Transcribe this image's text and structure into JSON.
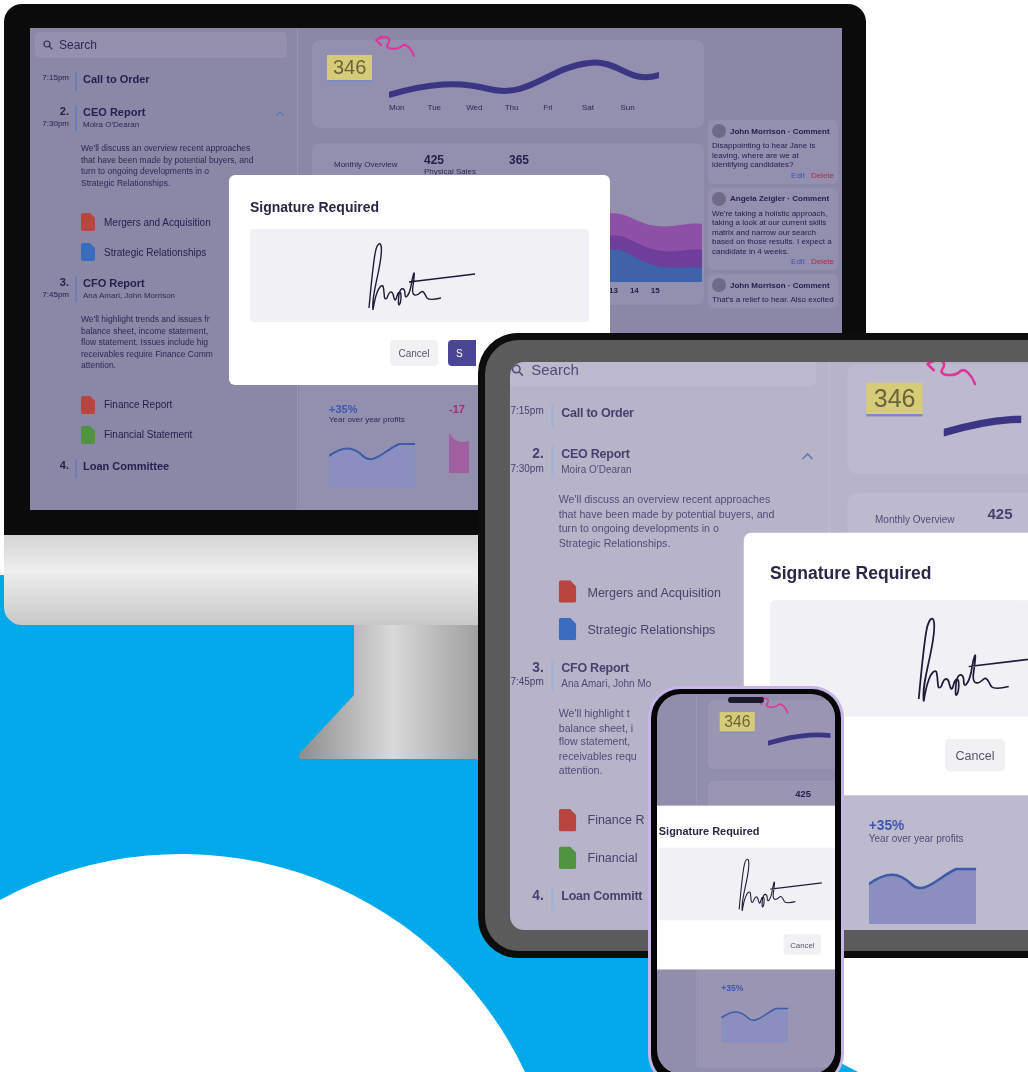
{
  "devices": [
    {
      "kind": "monitor",
      "app": {
        "search": {
          "placeholder": "Search"
        },
        "agenda": [
          {
            "time": "7:15pm",
            "title": "Call to Order"
          },
          {
            "number": "2.",
            "time": "7:30pm",
            "title": "CEO Report",
            "presenter": "Moira O'Dearan",
            "expanded": true,
            "description": "We'll discuss an overview recent approaches\nthat have been made by potential buyers, and\nturn to ongoing developments in o\nStrategic Relationships.",
            "attachments": [
              {
                "name": "Mergers and Acquisition",
                "kind": "pdf"
              },
              {
                "name": "Strategic Relationships",
                "kind": "word"
              }
            ]
          },
          {
            "number": "3.",
            "time": "7:45pm",
            "title": "CFO Report",
            "presenter": "Ana Amari, John Morrison",
            "description": "We'll highlight trends and issues fr\nbalance sheet, income statement,\nflow statement. Issues include hig\nreceivables require Finance Comm\nattention.",
            "attachments": [
              {
                "name": "Finance Report",
                "kind": "pdf"
              },
              {
                "name": "Financial Statement",
                "kind": "excel"
              }
            ]
          },
          {
            "number": "4.",
            "title": "Loan Committee"
          }
        ],
        "highlight": {
          "value": "346"
        },
        "days": [
          "Mon",
          "Tue",
          "Wed",
          "Thu",
          "Fri",
          "Sat",
          "Sun"
        ],
        "overview": {
          "title": "Monthly Overview",
          "stats": [
            {
              "value": "425",
              "label": "Physical Sales"
            },
            {
              "value": "365"
            }
          ],
          "axis": [
            "13",
            "14",
            "15"
          ]
        },
        "profits": [
          {
            "value": "+35%",
            "label": "Year over year profits",
            "kind": "gain"
          },
          {
            "value": "-17",
            "kind": "loss"
          }
        ],
        "comments": [
          {
            "author": "John Morrison · Comment",
            "text": "Disappointing to hear Jane is leaving, where are we at identifying candidates?",
            "actions": [
              {
                "label": "Edit",
                "kind": "edit"
              },
              {
                "label": "Delete",
                "kind": "delete"
              }
            ]
          },
          {
            "author": "Angela Zeigler · Comment",
            "text": "We're taking a holistic approach, taking a look at our current skills matrix and narrow our search based on those results. I expect a candidate in 4 weeks.",
            "actions": [
              {
                "label": "Edit",
                "kind": "edit"
              },
              {
                "label": "Delete",
                "kind": "delete"
              }
            ]
          },
          {
            "author": "John Morrison · Comment",
            "text": "That's a relief to hear. Also excited"
          }
        ],
        "dialog": {
          "title": "Signature Required",
          "buttons": [
            {
              "label": "Cancel",
              "kind": "secondary"
            },
            {
              "label": "S",
              "kind": "primary"
            }
          ]
        }
      }
    },
    {
      "kind": "tablet",
      "app": {
        "search": {
          "placeholder": "Search"
        },
        "agenda": [
          {
            "time": "7:15pm",
            "title": "Call to Order"
          },
          {
            "number": "2.",
            "time": "7:30pm",
            "title": "CEO Report",
            "presenter": "Moira O'Dearan",
            "expanded": true,
            "description": "We'll discuss an overview recent approaches\nthat have been made by potential buyers, and\nturn to ongoing developments in o\nStrategic Relationships.",
            "attachments": [
              {
                "name": "Mergers and Acquisition",
                "kind": "pdf"
              },
              {
                "name": "Strategic Relationships",
                "kind": "word"
              }
            ]
          },
          {
            "number": "3.",
            "time": "7:45pm",
            "title": "CFO Report",
            "presenter": "Ana Amari, John Mo",
            "description": "We'll highlight t\nbalance sheet, i\nflow statement,\nreceivables requ\nattention.",
            "attachments": [
              {
                "name": "Finance R",
                "kind": "pdf"
              },
              {
                "name": "Financial",
                "kind": "excel"
              }
            ]
          },
          {
            "number": "4.",
            "title": "Loan Committ"
          }
        ],
        "highlight": {
          "value": "346"
        },
        "overview": {
          "title": "Monthly Overview",
          "stats": [
            {
              "value": "425"
            }
          ]
        },
        "profits": [
          {
            "value": "+35%",
            "label": "Year over year profits",
            "kind": "gain"
          }
        ],
        "dialog": {
          "title": "Signature Required",
          "buttons": [
            {
              "label": "Cancel",
              "kind": "secondary"
            }
          ]
        }
      }
    },
    {
      "kind": "phone",
      "app": {
        "highlight": {
          "value": "346"
        },
        "overview": {
          "stats": [
            {
              "value": "425"
            }
          ]
        },
        "profits": [
          {
            "value": "+35%",
            "kind": "gain"
          }
        ],
        "dialog": {
          "title": "Signature Required",
          "buttons": [
            {
              "label": "Cancel",
              "kind": "secondary"
            }
          ]
        }
      }
    }
  ]
}
